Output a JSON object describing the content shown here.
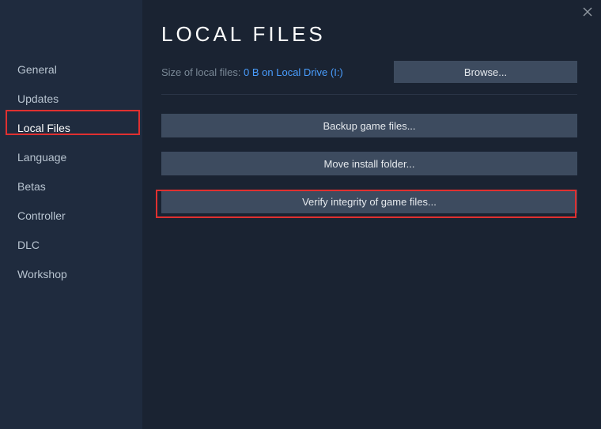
{
  "title": "LOCAL FILES",
  "info": {
    "label": "Size of local files: ",
    "link": "0 B on Local Drive (I:)"
  },
  "sidebar": {
    "items": [
      {
        "label": "General"
      },
      {
        "label": "Updates"
      },
      {
        "label": "Local Files"
      },
      {
        "label": "Language"
      },
      {
        "label": "Betas"
      },
      {
        "label": "Controller"
      },
      {
        "label": "DLC"
      },
      {
        "label": "Workshop"
      }
    ]
  },
  "buttons": {
    "browse": "Browse...",
    "backup": "Backup game files...",
    "move": "Move install folder...",
    "verify": "Verify integrity of game files..."
  }
}
